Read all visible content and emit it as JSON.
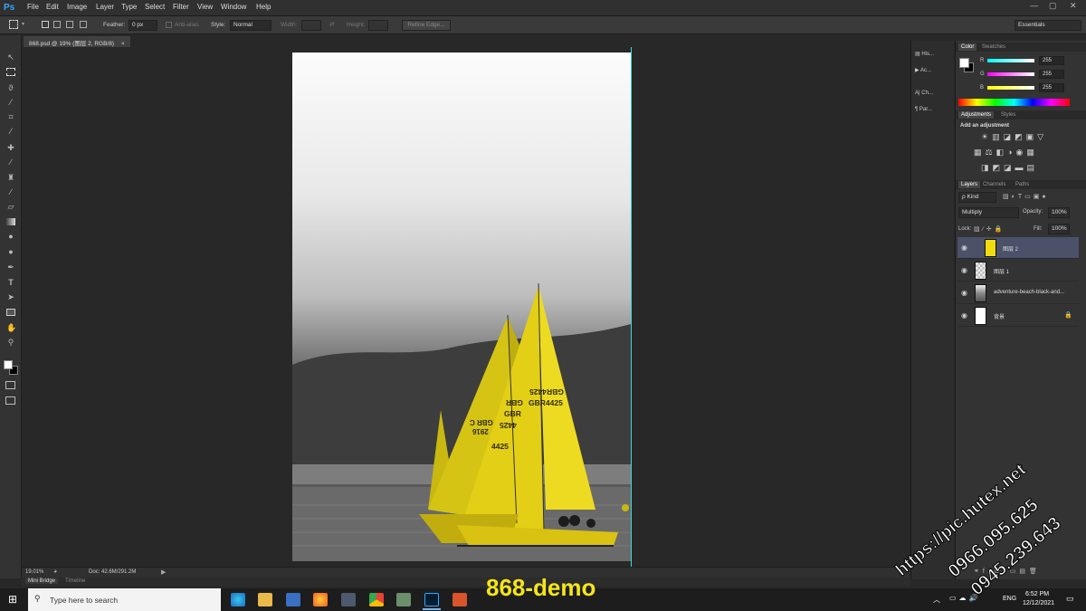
{
  "app": {
    "logo": "Ps"
  },
  "menu": [
    "File",
    "Edit",
    "Image",
    "Layer",
    "Type",
    "Select",
    "Filter",
    "View",
    "Window",
    "Help"
  ],
  "window_controls": {
    "minimize": "—",
    "maximize": "▢",
    "close": "✕"
  },
  "options": {
    "feather_label": "Feather:",
    "feather_value": "0 px",
    "antialias_label": "Anti-alias",
    "style_label": "Style:",
    "style_value": "Normal",
    "width_label": "Width:",
    "height_label": "Height:",
    "refine_edge": "Refine Edge...",
    "workspace": "Essentials"
  },
  "document": {
    "tab_title": "868.psd @ 19% (图层 2, RGB/8)",
    "tab_close": "×"
  },
  "status": {
    "zoom": "19.01%",
    "doc_info": "Doc: 42.6M/291.2M"
  },
  "bottom_tabs": [
    "Mini Bridge",
    "Timeline"
  ],
  "dock": [
    "His...",
    "Ac...",
    "Ch...",
    "Par..."
  ],
  "color_panel": {
    "tabs": [
      "Color",
      "Swatches"
    ],
    "r_label": "R",
    "r_value": "255",
    "g_label": "G",
    "g_value": "255",
    "b_label": "B",
    "b_value": "255"
  },
  "adjustments_panel": {
    "tabs": [
      "Adjustments",
      "Styles"
    ],
    "hint": "Add an adjustment"
  },
  "layers_panel": {
    "tabs": [
      "Layers",
      "Channels",
      "Paths"
    ],
    "kind": "ρ Kind",
    "blend_mode": "Multiply",
    "opacity_label": "Opacity:",
    "opacity_value": "100%",
    "lock_label": "Lock:",
    "fill_label": "Fill:",
    "fill_value": "100%",
    "layers": [
      {
        "name": "图层 2",
        "selected": true
      },
      {
        "name": "图层 1",
        "selected": false
      },
      {
        "name": "adventure-beach-black-and...",
        "selected": false
      },
      {
        "name": "背景",
        "selected": false
      }
    ]
  },
  "sail_texts": {
    "sail_a_top": "GBR4425",
    "sail_a_mid": "GBR4425",
    "sail_b_1": "GBR",
    "sail_b_2": "4425",
    "sail_b_3": "4425",
    "sail_c_1": "GBR C",
    "sail_c_2": "2916"
  },
  "overlay": {
    "caption": "868-demo",
    "watermark_1": "https://pic.hutex.net",
    "watermark_2": "0966.095.625",
    "watermark_3": "0945.239.643"
  },
  "taskbar": {
    "search_placeholder": "Type here to search",
    "lang": "ENG",
    "time": "6:52 PM",
    "date": "12/12/2021"
  },
  "colors": {
    "accent": "#31a8ff",
    "sail_yellow": "#e3cf16",
    "selected_layer": "#4a5168",
    "caption": "#f5e51b"
  }
}
